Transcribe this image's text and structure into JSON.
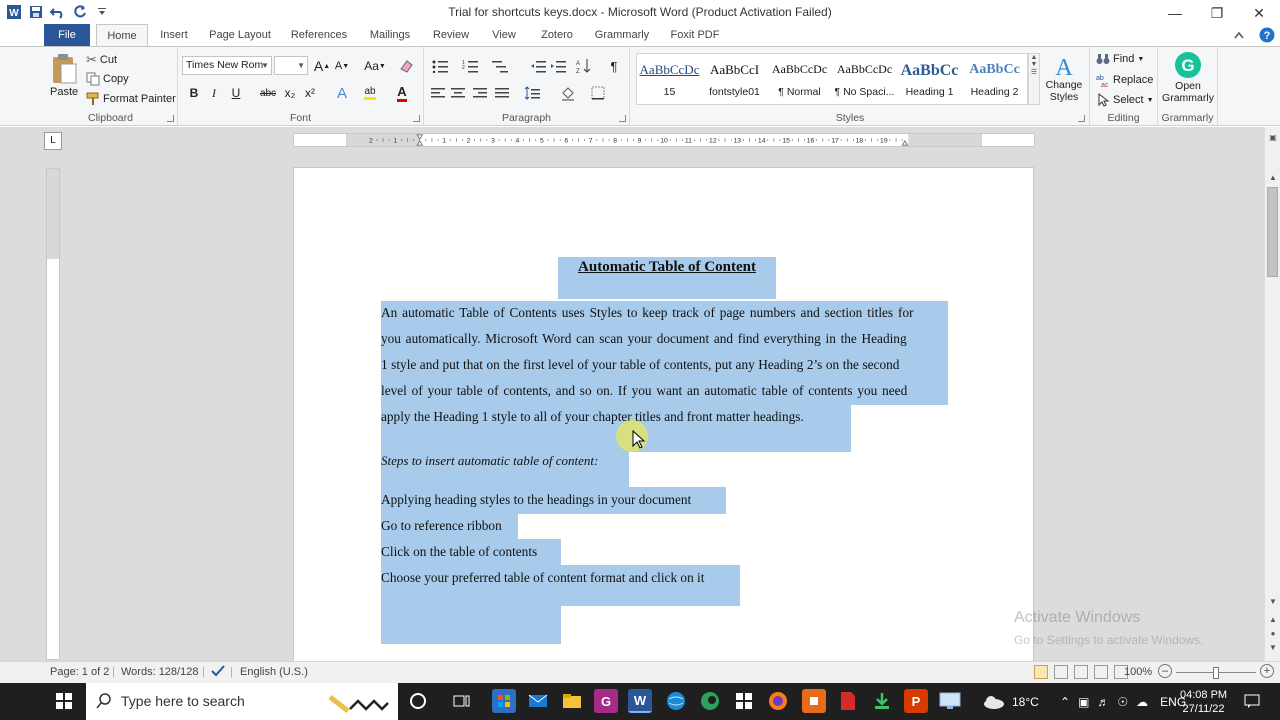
{
  "app": {
    "window_title": "Trial for shortcuts keys.docx  -  Microsoft Word (Product Activation Failed)"
  },
  "tabs": [
    "File",
    "Home",
    "Insert",
    "Page Layout",
    "References",
    "Mailings",
    "Review",
    "View",
    "Zotero",
    "Grammarly",
    "Foxit PDF"
  ],
  "active_tab": "Home",
  "clipboard": {
    "paste": "Paste",
    "cut": "Cut",
    "copy": "Copy",
    "format_painter": "Format Painter",
    "label": "Clipboard"
  },
  "font": {
    "name": "Times New Rom",
    "size": "",
    "label": "Font",
    "grow": "A",
    "shrink": "A",
    "case": "Aa",
    "bold": "B",
    "italic": "I",
    "underline": "U",
    "strike": "abc",
    "subscript": "x₂",
    "superscript": "x²",
    "effects": "A",
    "highlight": "ab",
    "color": "A"
  },
  "paragraph": {
    "label": "Paragraph",
    "pilcrow": "¶"
  },
  "styles": {
    "label": "Styles",
    "items": [
      {
        "sample": "AaBbCcDc",
        "name": "15"
      },
      {
        "sample": "AaBbCcI",
        "name": "fontstyle01"
      },
      {
        "sample": "AaBbCcDc",
        "name": "¶ Normal"
      },
      {
        "sample": "AaBbCcDc",
        "name": "¶ No Spaci..."
      },
      {
        "sample": "AaBbCс",
        "name": "Heading 1"
      },
      {
        "sample": "AaBbCc",
        "name": "Heading 2"
      }
    ],
    "change_styles": "Change Styles"
  },
  "editing": {
    "label": "Editing",
    "find": "Find",
    "replace": "Replace",
    "select": "Select"
  },
  "grammarly": {
    "label": "Grammarly",
    "open": "Open Grammarly"
  },
  "ruler": {
    "box": "L",
    "numbers": [
      "2",
      "1",
      "1",
      "2",
      "3",
      "4",
      "5",
      "6",
      "7",
      "8",
      "9",
      "10",
      "11",
      "12",
      "13",
      "14",
      "15",
      "16",
      "17",
      "18",
      "19"
    ]
  },
  "document": {
    "title": "Automatic Table of Content",
    "paragraph_lines": [
      "An automatic Table of Contents uses Styles to keep track of page numbers and section titles for",
      "you automatically. Microsoft Word can scan your document and find everything in the Heading",
      "1 style and put that on the first level of your table of contents, put any Heading 2’s on the second",
      "level of your table of contents, and so on. If you want an automatic table of contents you need",
      "apply the Heading 1 style to all of your chapter titles and front matter headings."
    ],
    "steps_title": "Steps to insert automatic table of content:",
    "steps": [
      "Applying heading styles to the headings in your document",
      "Go to reference ribbon",
      "Click on the table of contents",
      "Choose your preferred table of content format and click on it"
    ]
  },
  "status": {
    "page": "Page: 1 of 2",
    "words": "Words: 128/128",
    "language": "English (U.S.)",
    "zoom": "100%"
  },
  "watermark": {
    "line1": "Activate Windows",
    "line2": "Go to Settings to activate Windows."
  },
  "taskbar": {
    "search_placeholder": "Type here to search",
    "temperature": "18°C",
    "language": "ENG",
    "time": "04:08 PM",
    "date": "27/11/22"
  }
}
